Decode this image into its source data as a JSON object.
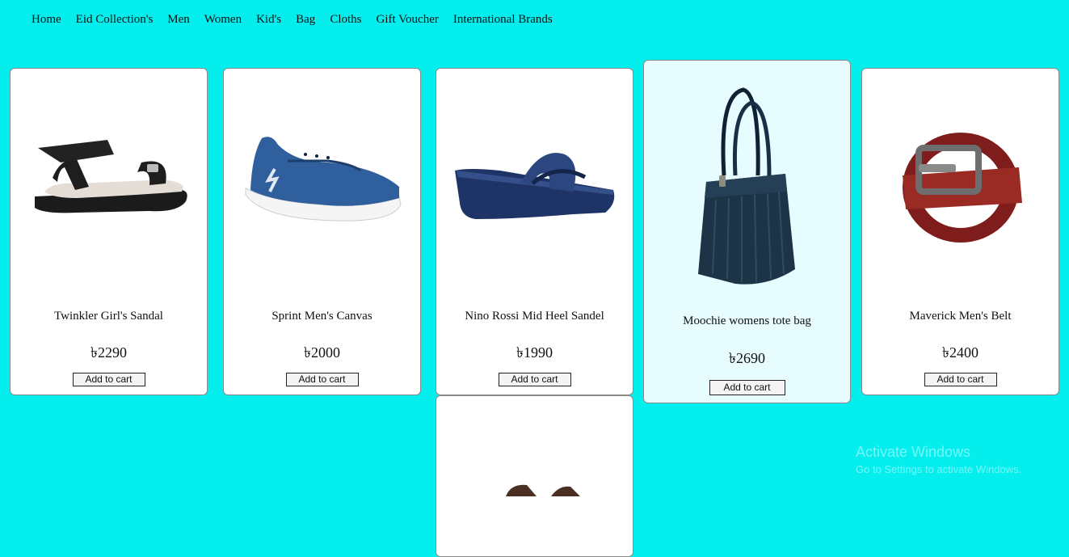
{
  "nav": {
    "items": [
      "Home",
      "Eid Collection's",
      "Men",
      "Women",
      "Kid's",
      "Bag",
      "Cloths",
      "Gift Voucher",
      "International Brands"
    ]
  },
  "products": [
    {
      "name": "Twinkler Girl's Sandal",
      "price": "৳2290",
      "button": "Add to cart",
      "icon": "sandal-image"
    },
    {
      "name": "Sprint Men's Canvas",
      "price": "৳2000",
      "button": "Add to cart",
      "icon": "sneaker-image"
    },
    {
      "name": "Nino Rossi Mid Heel Sandel",
      "price": "৳1990",
      "button": "Add to cart",
      "icon": "wedge-sandal-image"
    },
    {
      "name": "Moochie womens tote bag",
      "price": "৳2690",
      "button": "Add to cart",
      "icon": "tote-bag-image"
    },
    {
      "name": "Maverick Men's Belt",
      "price": "৳2400",
      "button": "Add to cart",
      "icon": "belt-image"
    }
  ],
  "extra_product": {
    "icon": "loafer-image"
  },
  "watermark": {
    "title": "Activate Windows",
    "subtitle": "Go to Settings to activate Windows."
  },
  "colors": {
    "background": "#05eeee",
    "card": "#ffffff",
    "card_hover": "#e6fcfe"
  }
}
